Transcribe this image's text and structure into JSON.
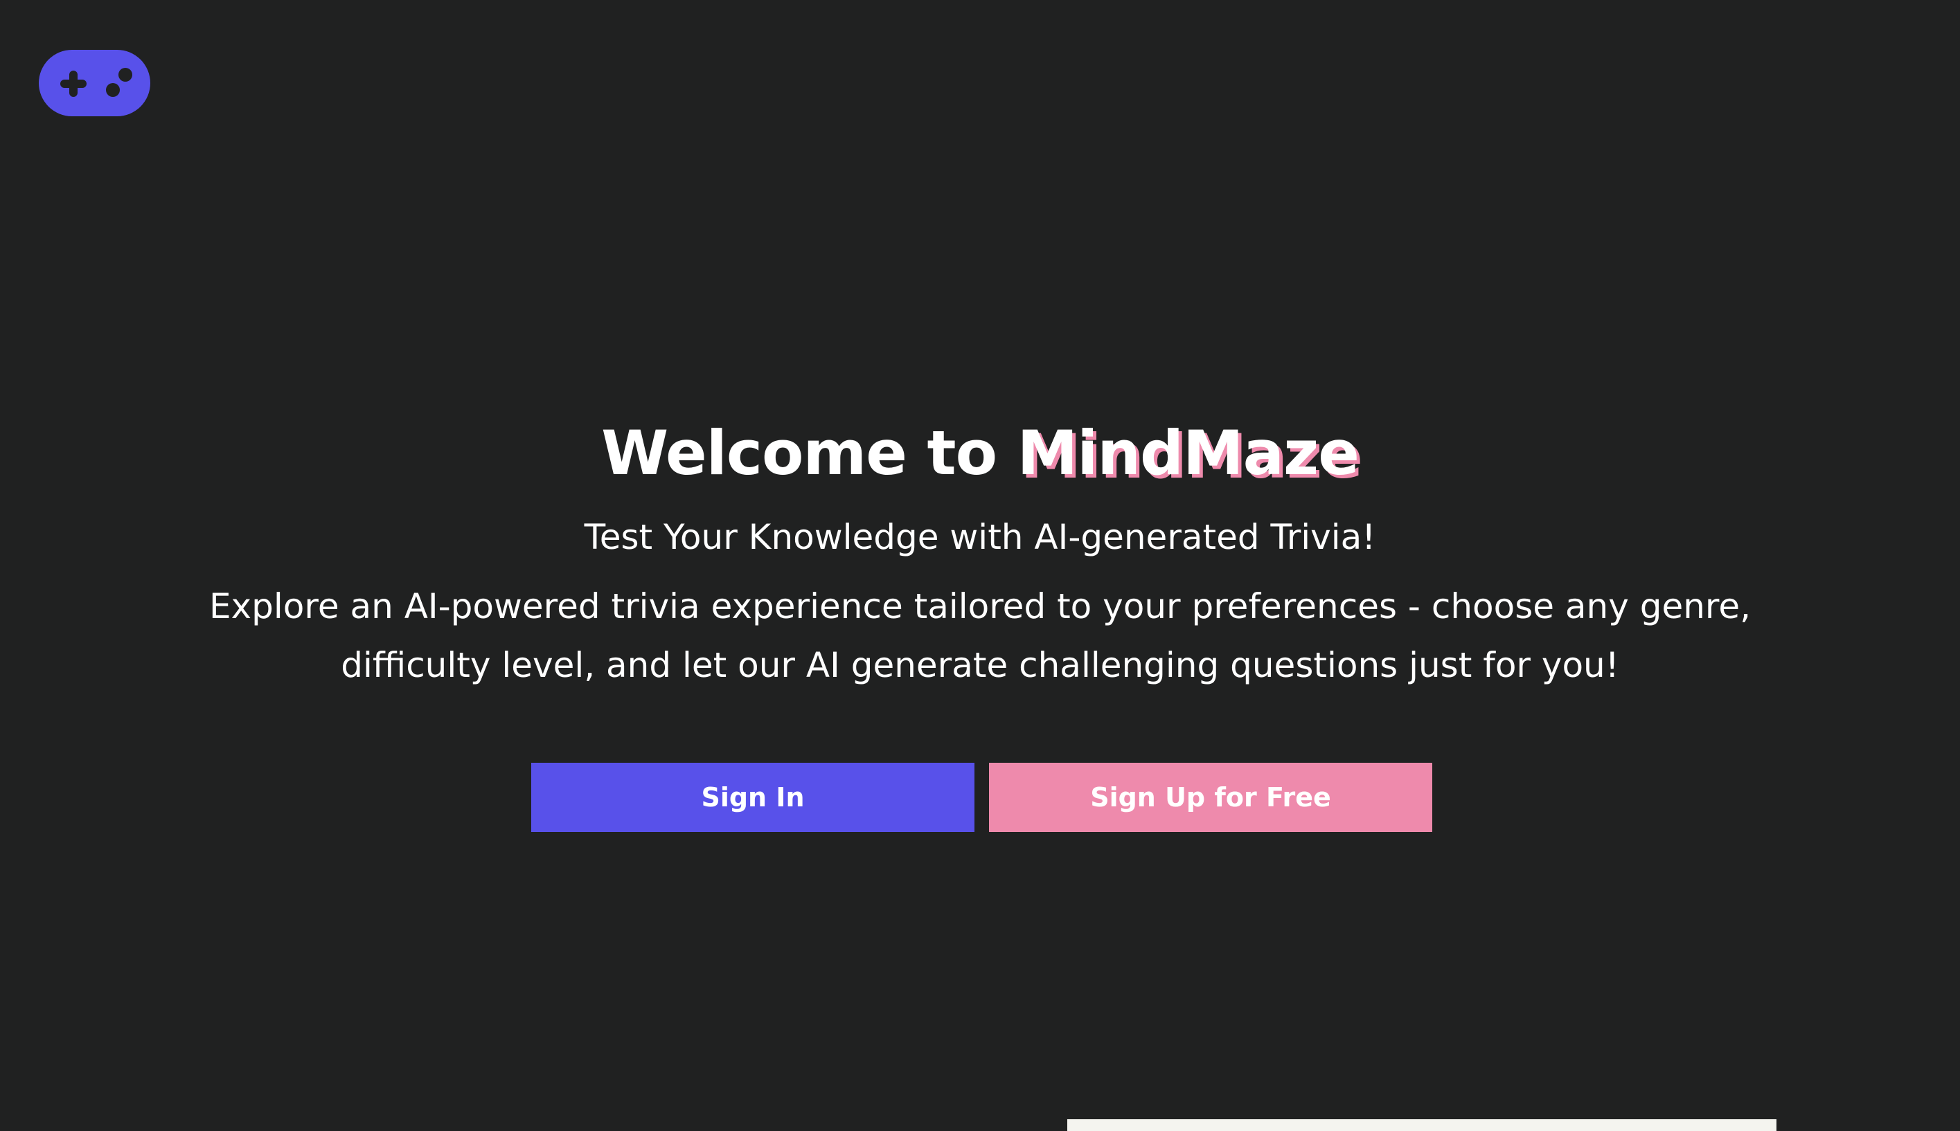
{
  "header": {
    "logo_icon": "gamepad-icon"
  },
  "hero": {
    "title_prefix": "Welcome to ",
    "brand_name": "MindMaze",
    "subtitle": "Test Your Knowledge with AI-generated Trivia!",
    "description": "Explore an AI-powered trivia experience tailored to your preferences - choose any genre, difficulty level, and let our AI generate challenging questions just for you!"
  },
  "actions": {
    "sign_in_label": "Sign In",
    "sign_up_label": "Sign Up for Free"
  },
  "colors": {
    "background": "#202121",
    "primary": "#5851ea",
    "accent": "#ee8aac",
    "text": "#ffffff"
  }
}
